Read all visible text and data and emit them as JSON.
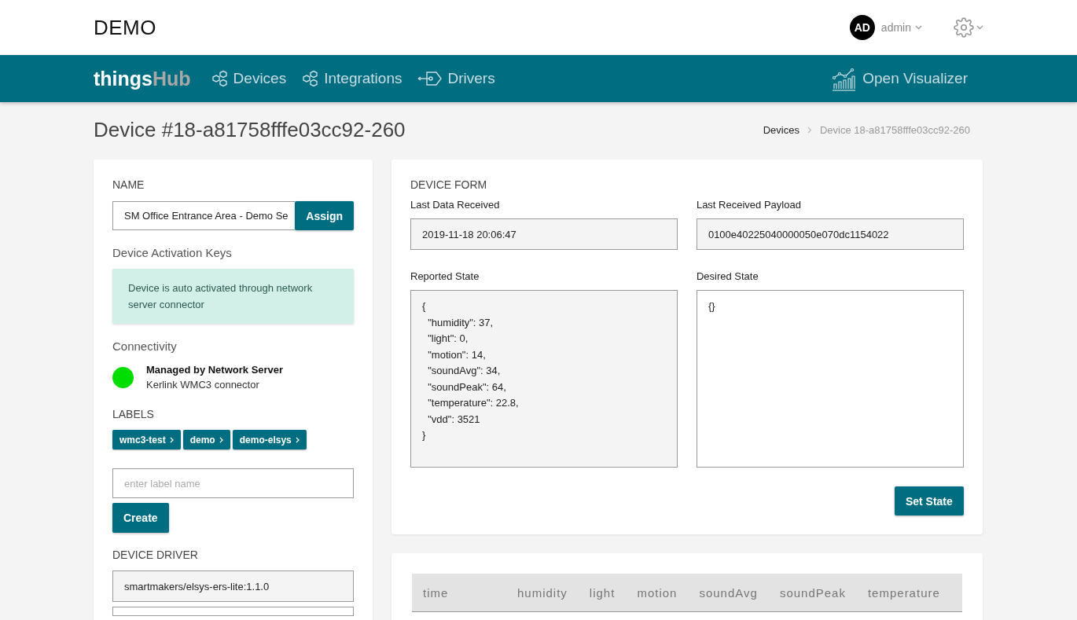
{
  "header": {
    "brand": "DEMO",
    "user": {
      "initials": "AD",
      "name": "admin"
    }
  },
  "nav": {
    "logo": {
      "first": "things",
      "second": "Hub"
    },
    "items": [
      {
        "label": "Devices",
        "kind": "hex"
      },
      {
        "label": "Integrations",
        "kind": "hex"
      },
      {
        "label": "Drivers",
        "kind": "plug"
      }
    ],
    "visualizer": "Open Visualizer"
  },
  "page": {
    "title": "Device #18-a81758fffe03cc92-260",
    "breadcrumb": [
      "Devices",
      "Device 18-a81758fffe03cc92-260"
    ]
  },
  "left": {
    "name_heading": "NAME",
    "name_value": "SM Office Entrance Area - Demo Se",
    "assign": "Assign",
    "activation_heading": "Device Activation Keys",
    "activation_note": "Device is auto activated through network server connector",
    "connectivity_heading": "Connectivity",
    "connectivity": {
      "color": "#00dd00",
      "title": "Managed by Network Server",
      "subtitle": "Kerlink WMC3 connector"
    },
    "labels_heading": "LABELS",
    "labels": [
      "wmc3-test",
      "demo",
      "demo-elsys"
    ],
    "label_placeholder": "enter label name",
    "create": "Create",
    "driver_heading": "DEVICE DRIVER",
    "driver_value": "smartmakers/elsys-ers-lite:1.1.0"
  },
  "form": {
    "heading": "DEVICE FORM",
    "last_data_label": "Last Data Received",
    "last_data": "2019-11-18 20:06:47",
    "payload_label": "Last Received Payload",
    "payload": "0100e40225040000050e070dc1154022",
    "reported_label": "Reported State",
    "reported": "{\n  \"humidity\": 37,\n  \"light\": 0,\n  \"motion\": 14,\n  \"soundAvg\": 34,\n  \"soundPeak\": 64,\n  \"temperature\": 22.8,\n  \"vdd\": 3521\n}",
    "desired_label": "Desired State",
    "desired": "{}",
    "set_state": "Set State"
  },
  "table": {
    "columns": [
      "time",
      "humidity",
      "light",
      "motion",
      "soundAvg",
      "soundPeak",
      "temperature"
    ]
  }
}
